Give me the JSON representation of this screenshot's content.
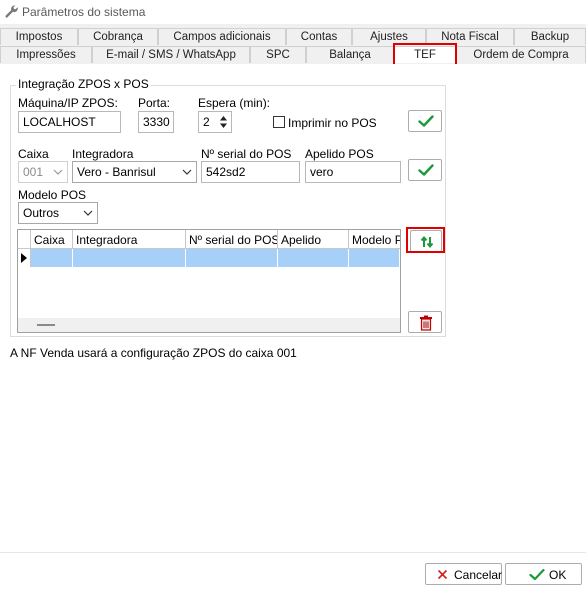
{
  "window": {
    "title": "Parâmetros do sistema"
  },
  "tabs_row1": [
    "Impostos",
    "Cobrança",
    "Campos adicionais",
    "Contas",
    "Ajustes",
    "Nota Fiscal",
    "Backup"
  ],
  "tabs_row2": [
    "Impressões",
    "E-mail / SMS / WhatsApp",
    "SPC",
    "Balança",
    "TEF",
    "Ordem de Compra"
  ],
  "selected_tab": "TEF",
  "group": {
    "title": "Integração ZPOS x POS",
    "host_label": "Máquina/IP ZPOS:",
    "host_value": "LOCALHOST",
    "port_label": "Porta:",
    "port_value": "3330",
    "wait_label": "Espera (min):",
    "wait_value": "2",
    "print_pos_label": "Imprimir no POS",
    "caixa_label": "Caixa",
    "caixa_value": "001",
    "integradora_label": "Integradora",
    "integradora_value": "Vero - Banrisul",
    "serial_label": "Nº serial do POS",
    "serial_value": "542sd2",
    "apelido_label": "Apelido POS",
    "apelido_value": "vero",
    "modelo_label": "Modelo POS",
    "modelo_value": "Outros"
  },
  "grid": {
    "columns": [
      "Caixa",
      "Integradora",
      "Nº serial do POS",
      "Apelido",
      "Modelo PC"
    ]
  },
  "info_text": "A NF Venda usará a configuração ZPOS do caixa 001",
  "footer": {
    "cancel_label": "Cancelar",
    "ok_label": "OK"
  },
  "colors": {
    "accent_red": "#e00000",
    "check_green": "#1a9a3a",
    "row_selected": "#a6d0f8"
  },
  "icons": [
    "wrench-icon",
    "check-icon",
    "swap-arrows-icon",
    "trash-icon",
    "close-x-icon",
    "row-pointer-icon"
  ]
}
